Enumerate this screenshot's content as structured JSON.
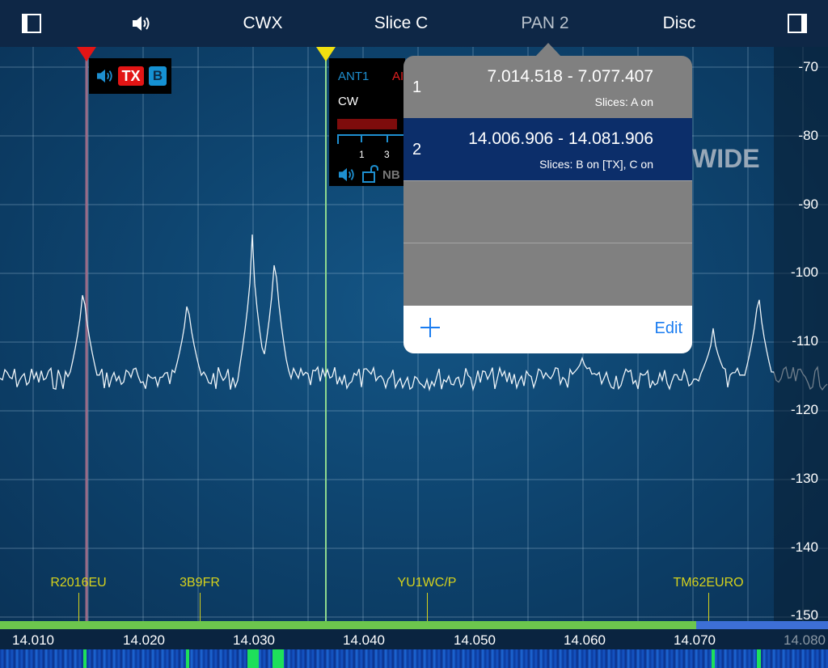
{
  "topbar": {
    "cwx": "CWX",
    "slice": "Slice C",
    "pan": "PAN 2",
    "disc": "Disc"
  },
  "icons": {
    "left_panel": "panel-left-icon",
    "speaker": "speaker-icon",
    "right_panel": "panel-right-icon"
  },
  "db_scale": [
    "-70",
    "-80",
    "-90",
    "-100",
    "-110",
    "-120",
    "-130",
    "-140",
    "-150"
  ],
  "freq_scale": [
    "14.010",
    "14.020",
    "14.030",
    "14.040",
    "14.050",
    "14.060",
    "14.070",
    "14.080"
  ],
  "spots": [
    "R2016EU",
    "3B9FR",
    "YU1WC/P",
    "TM62EURO"
  ],
  "slice_a_flag": {
    "tx": "TX",
    "letter": "B"
  },
  "slice_c_flag": {
    "antenna": "ANT1",
    "antenna2": "AI",
    "mode": "CW",
    "tick1": "1",
    "tick2": "3",
    "nb": "NB"
  },
  "wide_label": "WIDE",
  "popover": {
    "rows": [
      {
        "index": "1",
        "range": "7.014.518 - 7.077.407",
        "slices": "Slices: A on",
        "selected": false
      },
      {
        "index": "2",
        "range": "14.006.906 - 14.081.906",
        "slices": "Slices: B on [TX], C on",
        "selected": true
      }
    ],
    "edit": "Edit"
  },
  "colors": {
    "accent_blue": "#1a7cf0",
    "tx_red": "#e21515",
    "spot_yellow": "#d6d21c",
    "band_green": "#6cc64d",
    "selected_row": "#0c2e6a"
  }
}
